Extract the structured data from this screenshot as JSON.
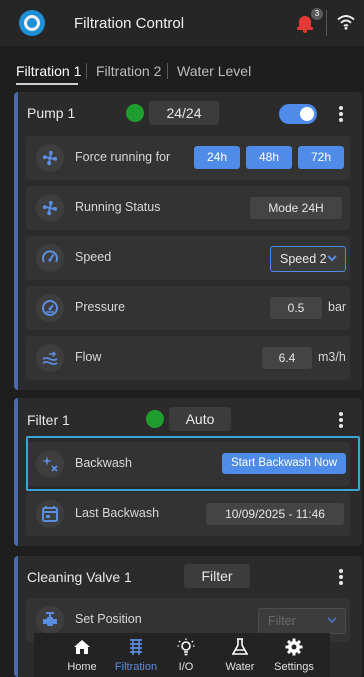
{
  "header": {
    "title": "Filtration Control",
    "notifications_count": "3"
  },
  "tabs": [
    {
      "label": "Filtration 1",
      "active": true
    },
    {
      "label": "Filtration 2",
      "active": false
    },
    {
      "label": "Water Level",
      "active": false
    }
  ],
  "pump": {
    "title": "Pump 1",
    "status_color": "#1f9e2f",
    "schedule": "24/24",
    "enabled": true,
    "rows": {
      "force_running": {
        "label": "Force running for",
        "options": [
          "24h",
          "48h",
          "72h"
        ]
      },
      "running_status": {
        "label": "Running Status",
        "value": "Mode 24H"
      },
      "speed": {
        "label": "Speed",
        "selected": "Speed 2"
      },
      "pressure": {
        "label": "Pressure",
        "value": "0.5",
        "unit": "bar"
      },
      "flow": {
        "label": "Flow",
        "value": "6.4",
        "unit": "m3/h"
      }
    }
  },
  "filter": {
    "title": "Filter 1",
    "status_color": "#1f9e2f",
    "mode": "Auto",
    "rows": {
      "backwash": {
        "label": "Backwash",
        "button": "Start Backwash Now"
      },
      "last_backwash": {
        "label": "Last Backwash",
        "value": "10/09/2025 - 11:46"
      }
    }
  },
  "valve": {
    "title": "Cleaning Valve 1",
    "mode": "Filter",
    "rows": {
      "set_position": {
        "label": "Set Position",
        "selected": "Filter"
      }
    }
  },
  "bottom_nav": [
    {
      "label": "Home",
      "icon": "home-icon",
      "active": false
    },
    {
      "label": "Filtration",
      "icon": "filtration-icon",
      "active": true
    },
    {
      "label": "I/O",
      "icon": "lightbulb-icon",
      "active": false
    },
    {
      "label": "Water",
      "icon": "flask-icon",
      "active": false
    },
    {
      "label": "Settings",
      "icon": "gear-icon",
      "active": false
    }
  ],
  "colors": {
    "accent": "#4f8be8",
    "status_ok": "#1f9e2f",
    "alert": "#e53935",
    "highlight": "#3aa6d8"
  }
}
